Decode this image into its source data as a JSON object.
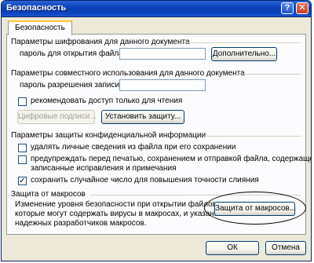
{
  "window": {
    "title": "Безопасность",
    "help_glyph": "?",
    "close_glyph": "✕"
  },
  "tab": {
    "label": "Безопасность"
  },
  "encryption": {
    "heading": "Параметры шифрования для данного документа",
    "password_label": "пароль для открытия файла:",
    "password_value": "",
    "advanced_button": "Дополнительно..."
  },
  "sharing": {
    "heading": "Параметры совместного использования для данного документа",
    "password_label": "пароль разрешения записи:",
    "password_value": "",
    "readonly_label": "рекомендовать доступ только для чтения",
    "readonly_checked": false,
    "digital_signatures_button": "Цифровые подписи...",
    "protect_button": "Установить защиту..."
  },
  "privacy": {
    "heading": "Параметры защиты конфиденциальной информации",
    "options": [
      {
        "label": "удалять личные сведения из файла при его сохранении",
        "checked": false
      },
      {
        "label_lines": [
          "предупреждать перед печатью, сохранением и отправкой файла, содержащего",
          "записанные исправления и примечания"
        ],
        "checked": false
      },
      {
        "label": "сохранить случайное число для повышения точности слияния",
        "checked": true
      }
    ]
  },
  "macro": {
    "heading": "Защита от макросов",
    "description_lines": [
      "Изменение уровня безопасности при открытии файлов,",
      "которые могут содержать вирусы в макросах, и указание",
      "надежных разработчиков макросов."
    ],
    "button": "Защита от макросов..."
  },
  "footer": {
    "ok": "ОК",
    "cancel": "Отмена"
  },
  "colors": {
    "titlebar": "#0a3fb5",
    "face": "#ece9d8",
    "tab_highlight": "#ffc83c"
  }
}
